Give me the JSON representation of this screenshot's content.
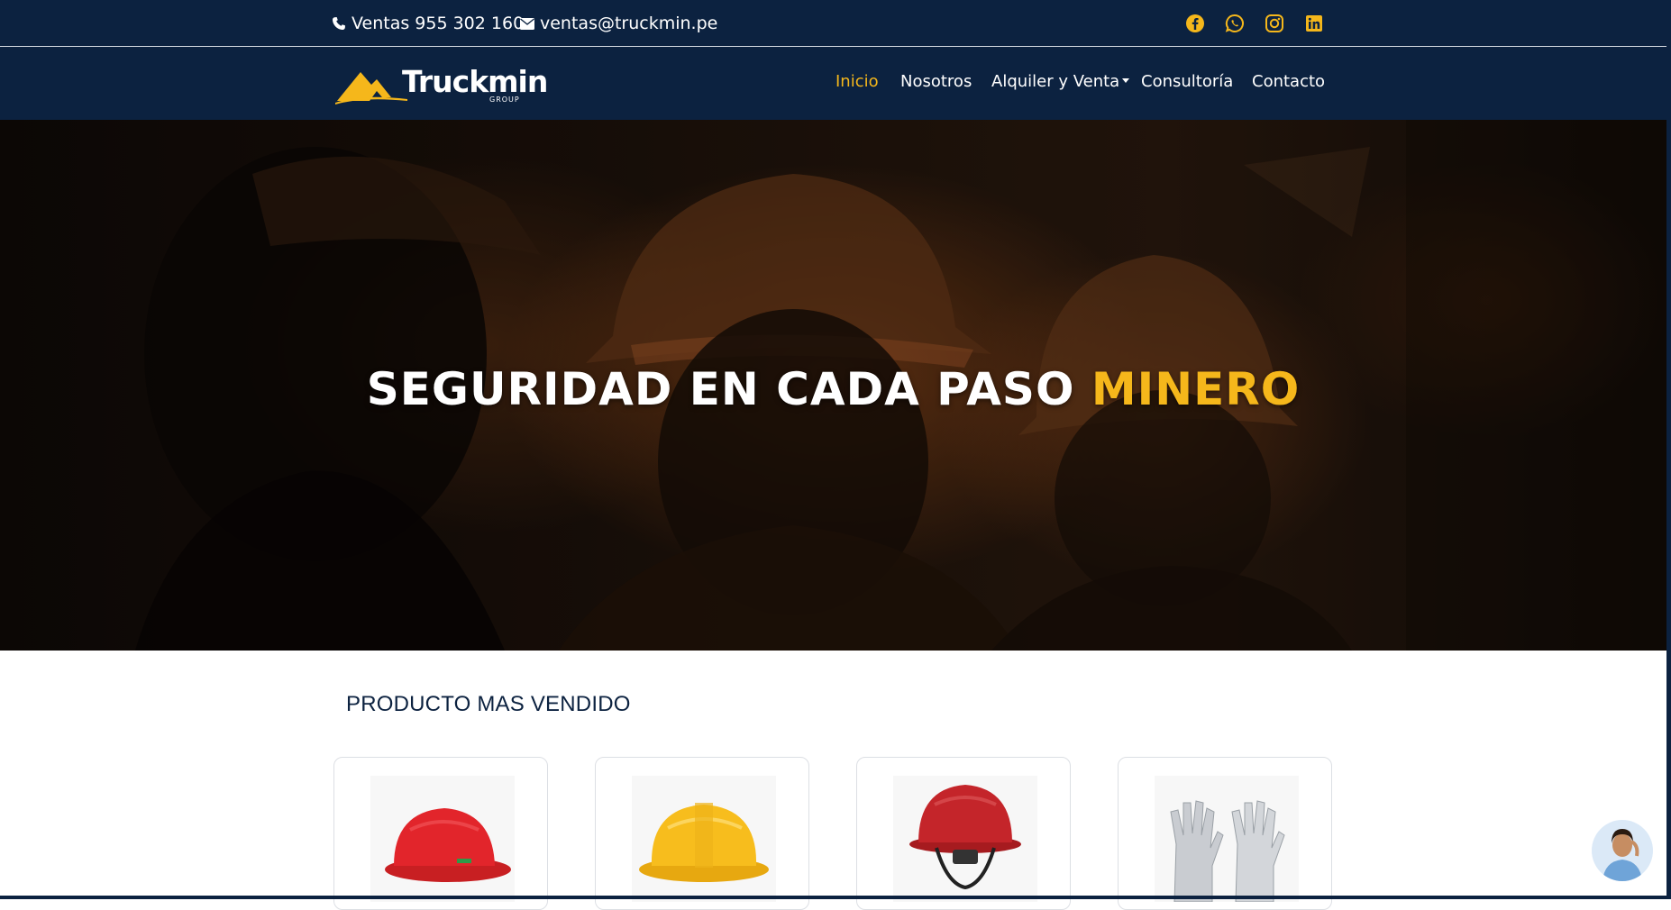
{
  "topbar": {
    "phone_text": "Ventas 955 302 160",
    "email_text": "ventas@truckmin.pe",
    "social_icons": [
      "facebook-icon",
      "whatsapp-icon",
      "instagram-icon",
      "linkedin-icon"
    ]
  },
  "brand": {
    "name": "Truckmin",
    "sub": "GROUP"
  },
  "nav": {
    "items": [
      {
        "label": "Inicio",
        "active": true
      },
      {
        "label": "Nosotros"
      },
      {
        "label": "Alquiler y Venta",
        "dropdown": true
      },
      {
        "label": "Consultoría"
      },
      {
        "label": "Contacto"
      }
    ]
  },
  "hero": {
    "title_main": "SEGURIDAD EN CADA PASO",
    "title_accent": "MINERO"
  },
  "products": {
    "section_title": "PRODUCTO MAS VENDIDO",
    "items": [
      {
        "image": "red-hard-hat"
      },
      {
        "image": "yellow-hard-hat"
      },
      {
        "image": "red-hard-hat-with-chin-strap"
      },
      {
        "image": "grey-work-gloves"
      }
    ]
  },
  "colors": {
    "navy": "#0c2240",
    "accent": "#f5b71b",
    "white": "#ffffff"
  }
}
